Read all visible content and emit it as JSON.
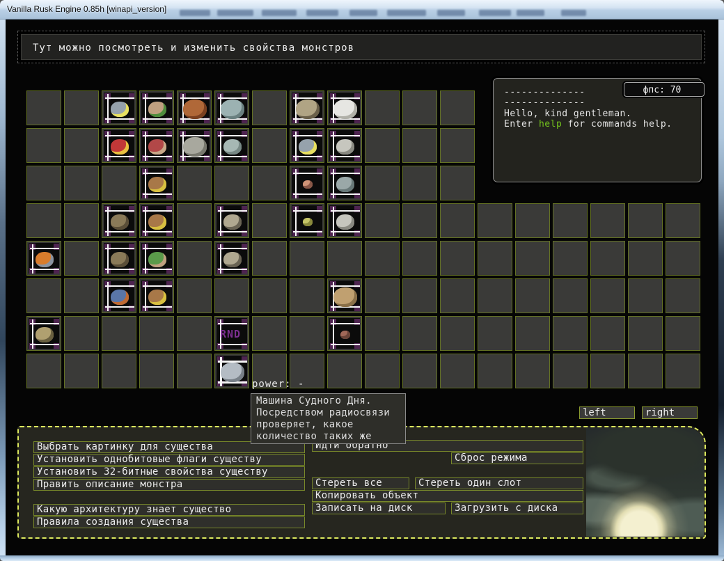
{
  "window": {
    "title": "Vanilla Rusk Engine 0.85h [winapi_version]"
  },
  "header": {
    "message": "Тут можно посмотреть и изменить свойства монстров"
  },
  "console": {
    "dash1": "--------------",
    "dash2": "--------------",
    "greeting": "Hello, kind gentleman.",
    "hint_pre": "Enter ",
    "hint_cmd": "help",
    "hint_post": " for commands help.",
    "cmd_color": "#74c41d",
    "fps_label": "фпс: 70"
  },
  "hover": {
    "power_label": "power: -",
    "tooltip_lines": [
      "Машина Судного Дня.",
      "Посредством радиосвязи",
      "проверяет, какое",
      "количество таких же"
    ]
  },
  "pager": {
    "left_label": "left",
    "right_label": "right"
  },
  "grid": {
    "tiles": [
      {
        "name": "bomb",
        "col": 2,
        "row": 0,
        "color": "#96a2ac",
        "accent": "#e8e060",
        "size": "md"
      },
      {
        "name": "hooded-ape",
        "col": 3,
        "row": 0,
        "color": "#c0a080",
        "accent": "#4e8c3c",
        "size": "md"
      },
      {
        "name": "bear",
        "col": 4,
        "row": 0,
        "color": "#b06838",
        "accent": "#7a4020",
        "size": "lg"
      },
      {
        "name": "grey-stag",
        "col": 5,
        "row": 0,
        "color": "#9cb2b2",
        "accent": "#6a8080",
        "size": "lg"
      },
      {
        "name": "bone-serpent",
        "col": 7,
        "row": 0,
        "color": "#b0a484",
        "accent": "#6a604a",
        "size": "lg"
      },
      {
        "name": "white-mass",
        "col": 8,
        "row": 0,
        "color": "#e6e6e2",
        "accent": "#b0b0a8",
        "size": "lg"
      },
      {
        "name": "crowned-king",
        "col": 2,
        "row": 1,
        "color": "#c23838",
        "accent": "#e8c040",
        "size": "md"
      },
      {
        "name": "red-ape",
        "col": 3,
        "row": 1,
        "color": "#b24848",
        "accent": "#c8a888",
        "size": "md"
      },
      {
        "name": "yeti",
        "col": 4,
        "row": 1,
        "color": "#a8a89e",
        "accent": "#78786e",
        "size": "lg"
      },
      {
        "name": "grey-doe",
        "col": 5,
        "row": 1,
        "color": "#a6b8b4",
        "accent": "#788a86",
        "size": "md"
      },
      {
        "name": "bomb",
        "col": 7,
        "row": 1,
        "color": "#96a2ac",
        "accent": "#e8e060",
        "size": "md"
      },
      {
        "name": "stone-egg",
        "col": 8,
        "row": 1,
        "color": "#c6c6be",
        "accent": "#8a8a82",
        "size": "md"
      },
      {
        "name": "ape",
        "col": 3,
        "row": 2,
        "color": "#a87848",
        "accent": "#d8c040",
        "size": "md"
      },
      {
        "name": "pink-critter",
        "col": 7,
        "row": 2,
        "color": "#d09478",
        "accent": "#8a5848",
        "size": "sm"
      },
      {
        "name": "worm",
        "col": 8,
        "row": 2,
        "color": "#9aa8a8",
        "accent": "#687878",
        "size": "md"
      },
      {
        "name": "lizard",
        "col": 2,
        "row": 3,
        "color": "#8a7a58",
        "accent": "#5a4e38",
        "size": "md"
      },
      {
        "name": "ape",
        "col": 3,
        "row": 3,
        "color": "#a87848",
        "accent": "#d8c040",
        "size": "md"
      },
      {
        "name": "rat",
        "col": 5,
        "row": 3,
        "color": "#b0a890",
        "accent": "#6a6454",
        "size": "md"
      },
      {
        "name": "chick",
        "col": 7,
        "row": 3,
        "color": "#c6c668",
        "accent": "#8a8a3c",
        "size": "sm"
      },
      {
        "name": "stone-egg",
        "col": 8,
        "row": 3,
        "color": "#c6c6be",
        "accent": "#8a8a82",
        "size": "md"
      },
      {
        "name": "robed-priest",
        "col": 0,
        "row": 4,
        "color": "#d87c2c",
        "accent": "#8a93a0",
        "size": "md"
      },
      {
        "name": "lizard",
        "col": 2,
        "row": 4,
        "color": "#8a7a58",
        "accent": "#5a4e38",
        "size": "md"
      },
      {
        "name": "green-ape",
        "col": 3,
        "row": 4,
        "color": "#5a9a4a",
        "accent": "#c0a080",
        "size": "md"
      },
      {
        "name": "rat",
        "col": 5,
        "row": 4,
        "color": "#b0a890",
        "accent": "#6a6454",
        "size": "md"
      },
      {
        "name": "blue-dwarf",
        "col": 2,
        "row": 5,
        "color": "#5a76a8",
        "accent": "#c06a32",
        "size": "md"
      },
      {
        "name": "ape",
        "col": 3,
        "row": 5,
        "color": "#a87848",
        "accent": "#d8c040",
        "size": "md"
      },
      {
        "name": "ant",
        "col": 8,
        "row": 5,
        "color": "#c0a070",
        "accent": "#8a7048",
        "size": "lg"
      },
      {
        "name": "horned-goat",
        "col": 0,
        "row": 6,
        "color": "#b0a070",
        "accent": "#6a6040",
        "size": "md"
      },
      {
        "name": "rnd-slot",
        "col": 5,
        "row": 6,
        "label": "RND R",
        "color": "#7c2f90",
        "size": "md"
      },
      {
        "name": "spider",
        "col": 8,
        "row": 6,
        "color": "#a06858",
        "accent": "#6a4438",
        "size": "sm"
      },
      {
        "name": "doomsday-machine",
        "col": 5,
        "row": 7,
        "color": "#b4bcc4",
        "accent": "#788088",
        "size": "lg",
        "selected": true
      }
    ]
  },
  "actions_left": [
    "Выбрать картинку для существа",
    "Установить однобитовые флаги существу",
    "Установить 32-битные свойства существу",
    "Править описание монстра",
    "Какую архитектуру знает существо",
    "Правила создания существа"
  ],
  "actions_right": [
    "Идти обратно",
    "Сброс режима",
    "Стереть все",
    "Стереть один слот",
    "Копировать объект",
    "Записать на диск",
    "Загрузить с диска"
  ],
  "colors": {
    "cell_border": "#6e801e",
    "panel_border": "#dce95e",
    "marker_purple": "#4e2450",
    "tile_bg": "#0b0b0b"
  }
}
